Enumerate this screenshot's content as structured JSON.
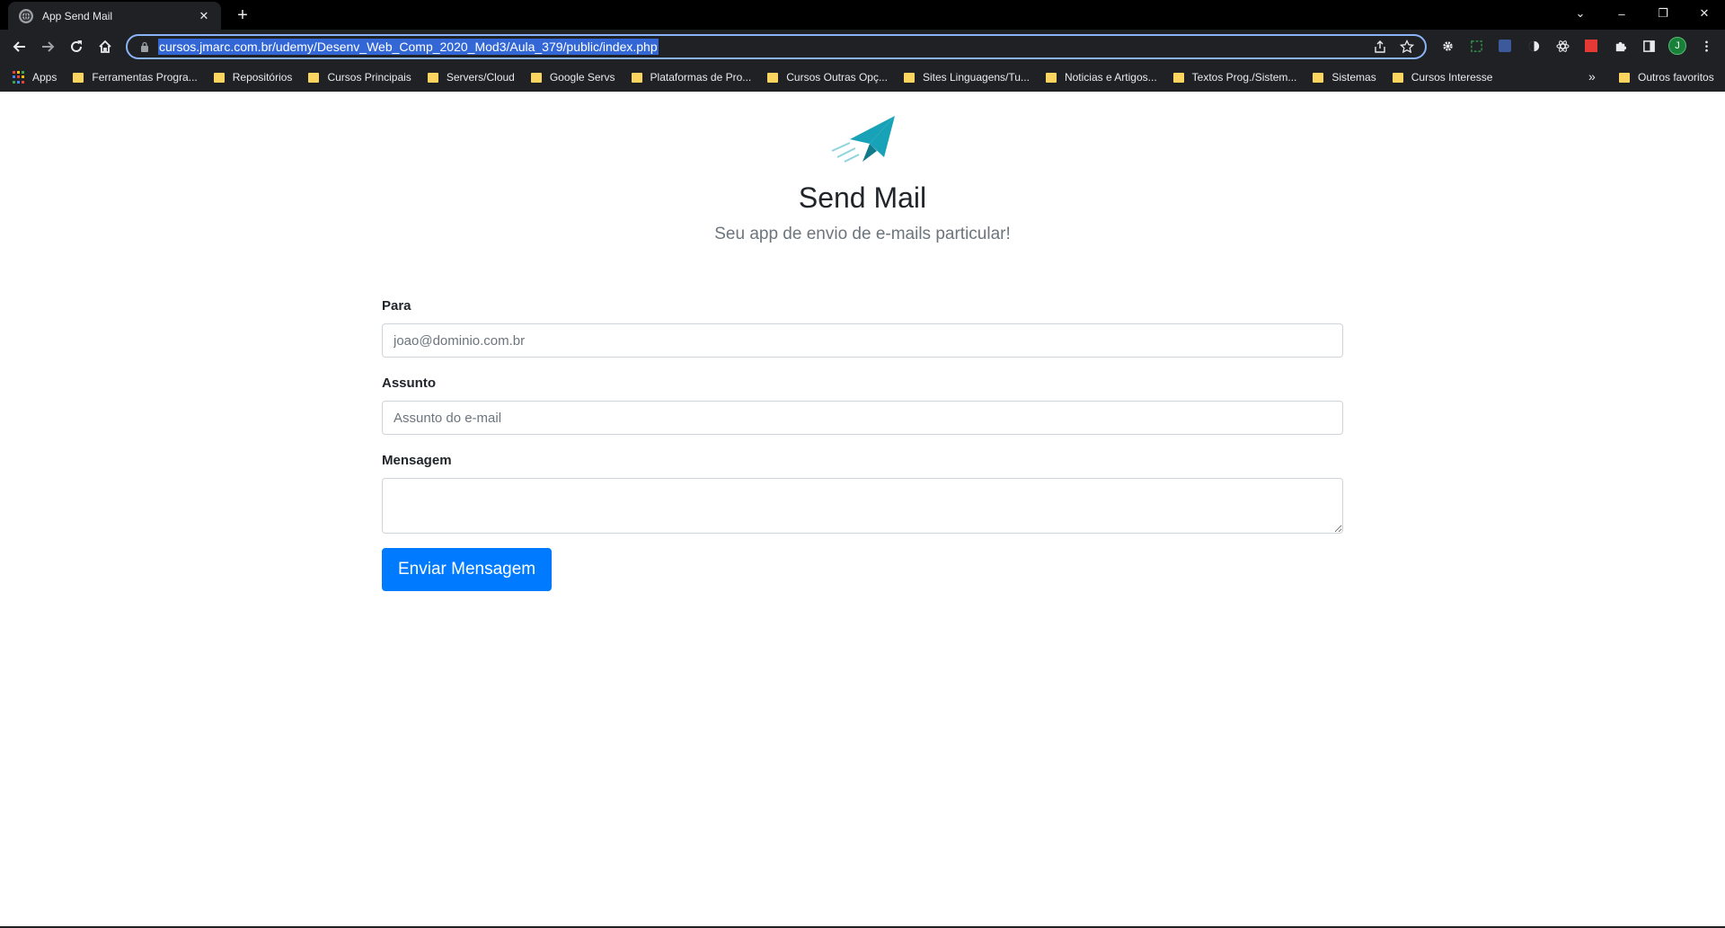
{
  "browser": {
    "tab_title": "App Send Mail",
    "tab_close": "✕",
    "new_tab": "+",
    "window_controls": {
      "dropdown": "⌄",
      "minimize": "–",
      "restore": "❐",
      "close": "✕"
    },
    "url": "cursos.jmarc.com.br/udemy/Desenv_Web_Comp_2020_Mod3/Aula_379/public/index.php",
    "profile_initial": "J",
    "bookmarks": [
      "Ferramentas Progra...",
      "Repositórios",
      "Cursos Principais",
      "Servers/Cloud",
      "Google Servs",
      "Plataformas de Pro...",
      "Cursos Outras Opç...",
      "Sites Linguagens/Tu...",
      "Noticias e Artigos...",
      "Textos Prog./Sistem...",
      "Sistemas",
      "Cursos Interesse"
    ],
    "apps_label": "Apps",
    "more_bookmarks": "»",
    "other_bookmarks": "Outros favoritos"
  },
  "page": {
    "title": "Send Mail",
    "subtitle": "Seu app de envio de e-mails particular!",
    "form": {
      "to_label": "Para",
      "to_placeholder": "joao@dominio.com.br",
      "subject_label": "Assunto",
      "subject_placeholder": "Assunto do e-mail",
      "message_label": "Mensagem",
      "submit_label": "Enviar Mensagem"
    }
  },
  "colors": {
    "accent": "#007bff",
    "logo": "#17a2b8",
    "chrome_bg": "#202124",
    "tabbar_bg": "#000000",
    "folder": "#fbd560"
  }
}
